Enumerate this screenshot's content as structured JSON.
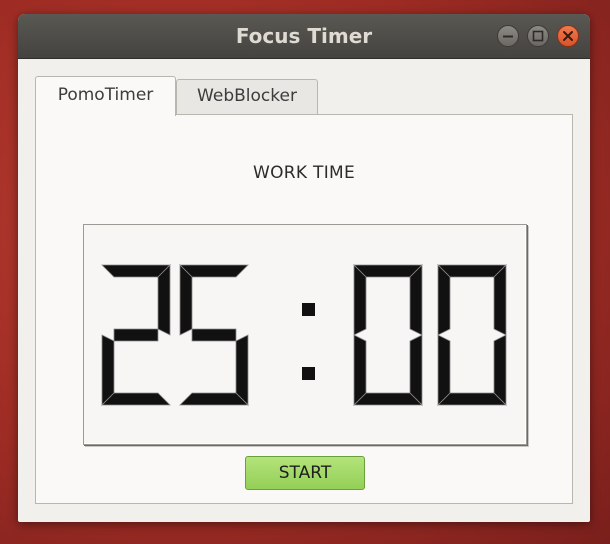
{
  "window": {
    "title": "Focus Timer"
  },
  "tabs": [
    {
      "label": "PomoTimer",
      "active": true
    },
    {
      "label": "WebBlocker",
      "active": false
    }
  ],
  "timer": {
    "mode_label": "WORK TIME",
    "display": "25:00",
    "minutes": "25",
    "seconds": "00"
  },
  "controls": {
    "start_label": "START"
  },
  "colors": {
    "titlebar": "#4f4d49",
    "close_button": "#e35d32",
    "start_button": "#a3d968",
    "lcd_segment": "#111111",
    "desktop": "#a3302a"
  },
  "icons": [
    "minimize-icon",
    "maximize-icon",
    "close-icon"
  ]
}
